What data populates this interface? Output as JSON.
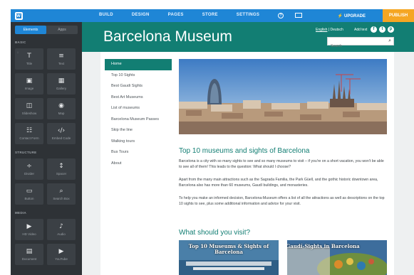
{
  "topbar": {
    "nav": [
      "BUILD",
      "DESIGN",
      "PAGES",
      "STORE",
      "SETTINGS"
    ],
    "upgrade": "UPGRADE",
    "publish": "PUBLISH"
  },
  "sidebar": {
    "tabs": [
      "Elements",
      "Apps"
    ],
    "sections": [
      "BASIC",
      "STRUCTURE",
      "MEDIA"
    ],
    "basic": [
      "Title",
      "Text",
      "Image",
      "Gallery",
      "Slideshow",
      "Map",
      "Contact Form",
      "Embed Code"
    ],
    "structure": [
      "Divider",
      "Spacer",
      "Button",
      "Search Box"
    ],
    "media": [
      "HD Video",
      "Audio",
      "Document",
      "YouTube"
    ]
  },
  "site": {
    "title": "Barcelona Museum",
    "lang_active": "English",
    "lang_other": "Deutsch",
    "add_text": "Add text",
    "search_placeholder": "Search",
    "menu": [
      "Home",
      "Top 10 Sights",
      "Best Gaudi Sights",
      "Best Art Museums",
      "List of museums",
      "Barcelona Museum Passes",
      "Skip the line",
      "Walking tours",
      "Bus Tours",
      "About"
    ],
    "heading": "Top 10 museums and sights of Barcelona",
    "para1": "Barcelona is a city with so many sights to see and so many museums to visit – if you're on a short vacation, you won't be able to see all of them! This leads to the question: What should I choose?",
    "para2": "Apart from the many main attractions such as the Sagrada Familia, the Park Güell, and the gothic historic downtown area, Barcelona also has more than 60 museums, Gaudí buildings, and monasteries.",
    "para3": "To help you make an informed decision, Barcelona-Museum offers a list of all the attractions as well as descriptions on the top 10 sights to see, plus some additional information and advice for your visit.",
    "subheading": "What should you visit?",
    "thumb1": "Top 10 Museums & Sights of Barcelona",
    "thumb2": "Best Gaudí-Sights in Barcelona"
  },
  "colors": {
    "accent": "#1f86d6",
    "teal": "#127e73",
    "publish": "#f5a623",
    "sidebar": "#2e3236"
  }
}
